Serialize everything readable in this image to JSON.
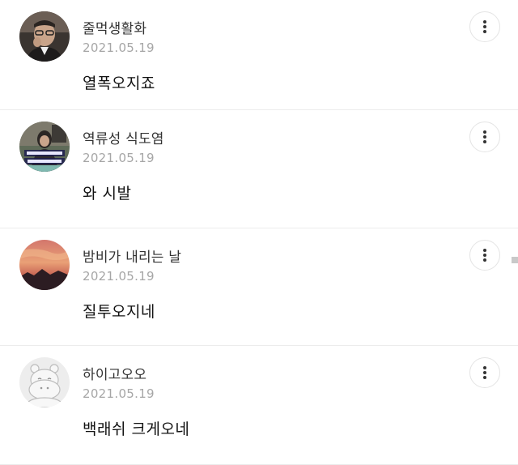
{
  "comments": [
    {
      "nickname": "줄먹생활화",
      "date": "2021.05.19",
      "text": "열폭오지죠",
      "avatar": "photo-man-glasses"
    },
    {
      "nickname": "역류성 식도염",
      "date": "2021.05.19",
      "text": "와 시발",
      "avatar": "tv-screenshot-caption"
    },
    {
      "nickname": "밤비가 내리는 날",
      "date": "2021.05.19",
      "text": "질투오지네",
      "avatar": "sunset-sky"
    },
    {
      "nickname": "하이고오오",
      "date": "2021.05.19",
      "text": "백래쉬 크게오네",
      "avatar": "default-hippo"
    }
  ],
  "icons": {
    "more": "more-vertical-icon"
  },
  "colors": {
    "nickname": "#333333",
    "date": "#a6a6a6",
    "text": "#111111",
    "divider": "#ececec"
  }
}
